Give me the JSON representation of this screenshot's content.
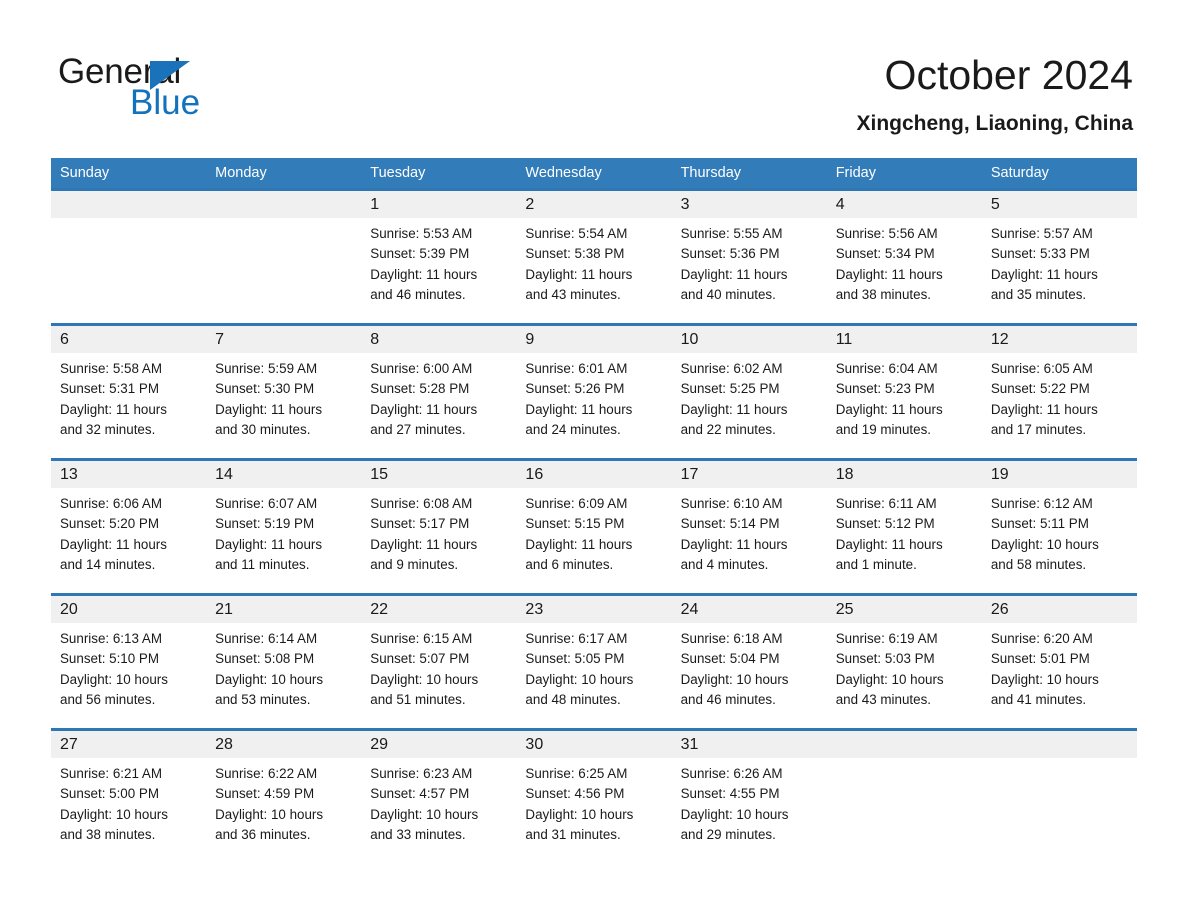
{
  "brand": {
    "name_part1": "General",
    "name_part2": "Blue",
    "triangle_color": "#1a72ba",
    "blue_color": "#1272bc"
  },
  "header": {
    "title": "October 2024",
    "subtitle": "Xingcheng, Liaoning, China"
  },
  "theme": {
    "header_blue": "#327cba",
    "row_divider_blue": "#2f76b5",
    "daynum_band_gray": "#f0f0f0",
    "text_color": "#1a1a1a"
  },
  "weekdays": [
    "Sunday",
    "Monday",
    "Tuesday",
    "Wednesday",
    "Thursday",
    "Friday",
    "Saturday"
  ],
  "weeks": [
    [
      {
        "day": "",
        "l1": "",
        "l2": "",
        "l3": "",
        "l4": ""
      },
      {
        "day": "",
        "l1": "",
        "l2": "",
        "l3": "",
        "l4": ""
      },
      {
        "day": "1",
        "l1": "Sunrise: 5:53 AM",
        "l2": "Sunset: 5:39 PM",
        "l3": "Daylight: 11 hours",
        "l4": "and 46 minutes."
      },
      {
        "day": "2",
        "l1": "Sunrise: 5:54 AM",
        "l2": "Sunset: 5:38 PM",
        "l3": "Daylight: 11 hours",
        "l4": "and 43 minutes."
      },
      {
        "day": "3",
        "l1": "Sunrise: 5:55 AM",
        "l2": "Sunset: 5:36 PM",
        "l3": "Daylight: 11 hours",
        "l4": "and 40 minutes."
      },
      {
        "day": "4",
        "l1": "Sunrise: 5:56 AM",
        "l2": "Sunset: 5:34 PM",
        "l3": "Daylight: 11 hours",
        "l4": "and 38 minutes."
      },
      {
        "day": "5",
        "l1": "Sunrise: 5:57 AM",
        "l2": "Sunset: 5:33 PM",
        "l3": "Daylight: 11 hours",
        "l4": "and 35 minutes."
      }
    ],
    [
      {
        "day": "6",
        "l1": "Sunrise: 5:58 AM",
        "l2": "Sunset: 5:31 PM",
        "l3": "Daylight: 11 hours",
        "l4": "and 32 minutes."
      },
      {
        "day": "7",
        "l1": "Sunrise: 5:59 AM",
        "l2": "Sunset: 5:30 PM",
        "l3": "Daylight: 11 hours",
        "l4": "and 30 minutes."
      },
      {
        "day": "8",
        "l1": "Sunrise: 6:00 AM",
        "l2": "Sunset: 5:28 PM",
        "l3": "Daylight: 11 hours",
        "l4": "and 27 minutes."
      },
      {
        "day": "9",
        "l1": "Sunrise: 6:01 AM",
        "l2": "Sunset: 5:26 PM",
        "l3": "Daylight: 11 hours",
        "l4": "and 24 minutes."
      },
      {
        "day": "10",
        "l1": "Sunrise: 6:02 AM",
        "l2": "Sunset: 5:25 PM",
        "l3": "Daylight: 11 hours",
        "l4": "and 22 minutes."
      },
      {
        "day": "11",
        "l1": "Sunrise: 6:04 AM",
        "l2": "Sunset: 5:23 PM",
        "l3": "Daylight: 11 hours",
        "l4": "and 19 minutes."
      },
      {
        "day": "12",
        "l1": "Sunrise: 6:05 AM",
        "l2": "Sunset: 5:22 PM",
        "l3": "Daylight: 11 hours",
        "l4": "and 17 minutes."
      }
    ],
    [
      {
        "day": "13",
        "l1": "Sunrise: 6:06 AM",
        "l2": "Sunset: 5:20 PM",
        "l3": "Daylight: 11 hours",
        "l4": "and 14 minutes."
      },
      {
        "day": "14",
        "l1": "Sunrise: 6:07 AM",
        "l2": "Sunset: 5:19 PM",
        "l3": "Daylight: 11 hours",
        "l4": "and 11 minutes."
      },
      {
        "day": "15",
        "l1": "Sunrise: 6:08 AM",
        "l2": "Sunset: 5:17 PM",
        "l3": "Daylight: 11 hours",
        "l4": "and 9 minutes."
      },
      {
        "day": "16",
        "l1": "Sunrise: 6:09 AM",
        "l2": "Sunset: 5:15 PM",
        "l3": "Daylight: 11 hours",
        "l4": "and 6 minutes."
      },
      {
        "day": "17",
        "l1": "Sunrise: 6:10 AM",
        "l2": "Sunset: 5:14 PM",
        "l3": "Daylight: 11 hours",
        "l4": "and 4 minutes."
      },
      {
        "day": "18",
        "l1": "Sunrise: 6:11 AM",
        "l2": "Sunset: 5:12 PM",
        "l3": "Daylight: 11 hours",
        "l4": "and 1 minute."
      },
      {
        "day": "19",
        "l1": "Sunrise: 6:12 AM",
        "l2": "Sunset: 5:11 PM",
        "l3": "Daylight: 10 hours",
        "l4": "and 58 minutes."
      }
    ],
    [
      {
        "day": "20",
        "l1": "Sunrise: 6:13 AM",
        "l2": "Sunset: 5:10 PM",
        "l3": "Daylight: 10 hours",
        "l4": "and 56 minutes."
      },
      {
        "day": "21",
        "l1": "Sunrise: 6:14 AM",
        "l2": "Sunset: 5:08 PM",
        "l3": "Daylight: 10 hours",
        "l4": "and 53 minutes."
      },
      {
        "day": "22",
        "l1": "Sunrise: 6:15 AM",
        "l2": "Sunset: 5:07 PM",
        "l3": "Daylight: 10 hours",
        "l4": "and 51 minutes."
      },
      {
        "day": "23",
        "l1": "Sunrise: 6:17 AM",
        "l2": "Sunset: 5:05 PM",
        "l3": "Daylight: 10 hours",
        "l4": "and 48 minutes."
      },
      {
        "day": "24",
        "l1": "Sunrise: 6:18 AM",
        "l2": "Sunset: 5:04 PM",
        "l3": "Daylight: 10 hours",
        "l4": "and 46 minutes."
      },
      {
        "day": "25",
        "l1": "Sunrise: 6:19 AM",
        "l2": "Sunset: 5:03 PM",
        "l3": "Daylight: 10 hours",
        "l4": "and 43 minutes."
      },
      {
        "day": "26",
        "l1": "Sunrise: 6:20 AM",
        "l2": "Sunset: 5:01 PM",
        "l3": "Daylight: 10 hours",
        "l4": "and 41 minutes."
      }
    ],
    [
      {
        "day": "27",
        "l1": "Sunrise: 6:21 AM",
        "l2": "Sunset: 5:00 PM",
        "l3": "Daylight: 10 hours",
        "l4": "and 38 minutes."
      },
      {
        "day": "28",
        "l1": "Sunrise: 6:22 AM",
        "l2": "Sunset: 4:59 PM",
        "l3": "Daylight: 10 hours",
        "l4": "and 36 minutes."
      },
      {
        "day": "29",
        "l1": "Sunrise: 6:23 AM",
        "l2": "Sunset: 4:57 PM",
        "l3": "Daylight: 10 hours",
        "l4": "and 33 minutes."
      },
      {
        "day": "30",
        "l1": "Sunrise: 6:25 AM",
        "l2": "Sunset: 4:56 PM",
        "l3": "Daylight: 10 hours",
        "l4": "and 31 minutes."
      },
      {
        "day": "31",
        "l1": "Sunrise: 6:26 AM",
        "l2": "Sunset: 4:55 PM",
        "l3": "Daylight: 10 hours",
        "l4": "and 29 minutes."
      },
      {
        "day": "",
        "l1": "",
        "l2": "",
        "l3": "",
        "l4": ""
      },
      {
        "day": "",
        "l1": "",
        "l2": "",
        "l3": "",
        "l4": ""
      }
    ]
  ]
}
